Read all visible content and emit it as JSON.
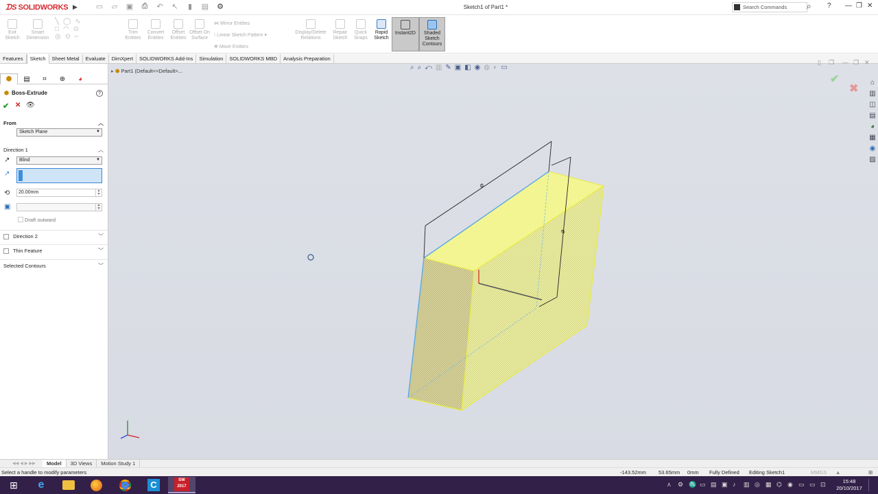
{
  "app": {
    "brand": "SOLIDWORKS",
    "doc_title": "Sketch1 of Part1 *",
    "search_placeholder": "Search Commands",
    "help_label": "?"
  },
  "command_manager": {
    "exit_sketch": "Exit Sketch",
    "smart_dimension": "Smart Dimension",
    "trim_entities": "Trim Entities",
    "convert_entities": "Convert Entities",
    "offset_entities": "Offset Entities",
    "offset_on_surface": "Offset On Surface",
    "mirror_entities": "Mirror Entities",
    "linear_sketch_pattern": "Linear Sketch Pattern",
    "move_entities": "Move Entities",
    "display_delete_relations": "Display/Delete Relations",
    "repair_sketch": "Repair Sketch",
    "quick_snaps": "Quick Snaps",
    "rapid_sketch": "Rapid Sketch",
    "instant2d": "Instant2D",
    "shaded_sketch_contours": "Shaded Sketch Contours"
  },
  "tabs": [
    "Features",
    "Sketch",
    "Sheet Metal",
    "Evaluate",
    "DimXpert",
    "SOLIDWORKS Add-Ins",
    "Simulation",
    "SOLIDWORKS MBD",
    "Analysis Preparation"
  ],
  "active_tab": "Sketch",
  "property_manager": {
    "title": "Boss-Extrude",
    "from_label": "From",
    "from_value": "Sketch Plane",
    "direction1_label": "Direction 1",
    "end_condition": "Blind",
    "depth": "20.00mm",
    "draft_outward": "Draft outward",
    "direction2_label": "Direction 2",
    "thin_feature_label": "Thin Feature",
    "selected_contours_label": "Selected Contours"
  },
  "graphics": {
    "tree_label": "Part1  (Default<<Default>..."
  },
  "bottom_tabs": [
    "Model",
    "3D Views",
    "Motion Study 1"
  ],
  "active_bottom_tab": "Model",
  "status": {
    "message": "Select a handle to modify parameters",
    "x": "-143.52mm",
    "y": "53.65mm",
    "z": "0mm",
    "definition": "Fully Defined",
    "mode": "Editing Sketch1",
    "units": "MMGS"
  },
  "taskbar": {
    "time": "15:48",
    "date": "20/10/2017",
    "sw_badge": "2017"
  },
  "colors": {
    "accent_red": "#d8282f",
    "selection_blue": "#3a87d8",
    "preview_yellow": "#f4f78a",
    "taskbar": "#322048"
  }
}
